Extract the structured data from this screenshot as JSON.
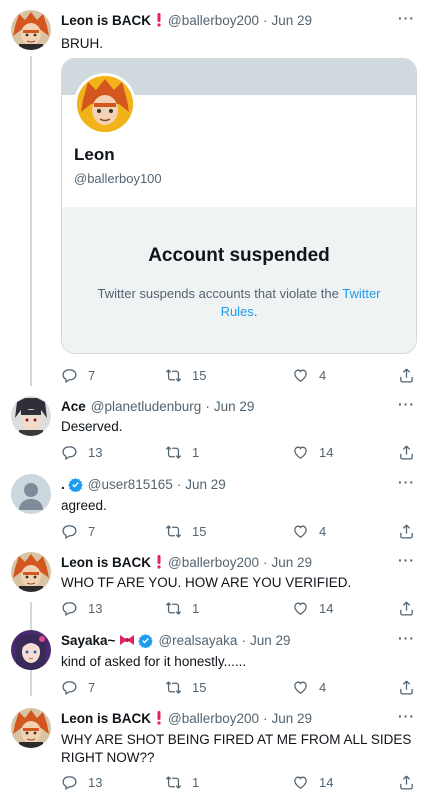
{
  "tweets": [
    {
      "name": "Leon is BACK",
      "emoji": "exclamation",
      "handle": "@ballerboy200",
      "date": "Jun 29",
      "text": "BRUH.",
      "counts": {
        "replies": "7",
        "retweets": "15",
        "likes": "4"
      },
      "avatar": "leon-avatar",
      "card": {
        "name": "Leon",
        "handle": "@ballerboy100",
        "suspended_title": "Account suspended",
        "suspended_body": "Twitter suspends accounts that violate the ",
        "suspended_link": "Twitter Rules",
        "suspended_end": "."
      }
    },
    {
      "name": "Ace",
      "handle": "@planetludenburg",
      "date": "Jun 29",
      "text": "Deserved.",
      "counts": {
        "replies": "13",
        "retweets": "1",
        "likes": "14"
      },
      "avatar": "ace-avatar"
    },
    {
      "name": ".",
      "verified": true,
      "handle": "@user815165",
      "date": "Jun 29",
      "text": "agreed.",
      "counts": {
        "replies": "7",
        "retweets": "15",
        "likes": "4"
      },
      "avatar": "default-avatar"
    },
    {
      "name": "Leon is BACK",
      "emoji": "exclamation",
      "handle": "@ballerboy200",
      "date": "Jun 29",
      "text": "WHO TF ARE YOU. HOW ARE YOU VERIFIED.",
      "counts": {
        "replies": "13",
        "retweets": "1",
        "likes": "14"
      },
      "avatar": "leon-avatar"
    },
    {
      "name": "Sayaka~",
      "emoji": "ribbon",
      "verified": true,
      "handle": "@realsayaka",
      "date": "Jun 29",
      "text": "kind of asked for it honestly......",
      "counts": {
        "replies": "7",
        "retweets": "15",
        "likes": "4"
      },
      "avatar": "sayaka-avatar"
    },
    {
      "name": "Leon is BACK",
      "emoji": "exclamation",
      "handle": "@ballerboy200",
      "date": "Jun 29",
      "text": "WHY ARE SHOT BEING FIRED AT ME FROM ALL SIDES RIGHT NOW??",
      "counts": {
        "replies": "13",
        "retweets": "1",
        "likes": "14"
      },
      "avatar": "leon-avatar"
    }
  ],
  "separator": "·",
  "more_label": "···",
  "colors": {
    "text": "#0f1419",
    "secondary": "#536471",
    "link": "#1d9bf0",
    "border": "#cfd9de",
    "verified": "#1d9bf0",
    "exclamation": "#e0245e"
  }
}
